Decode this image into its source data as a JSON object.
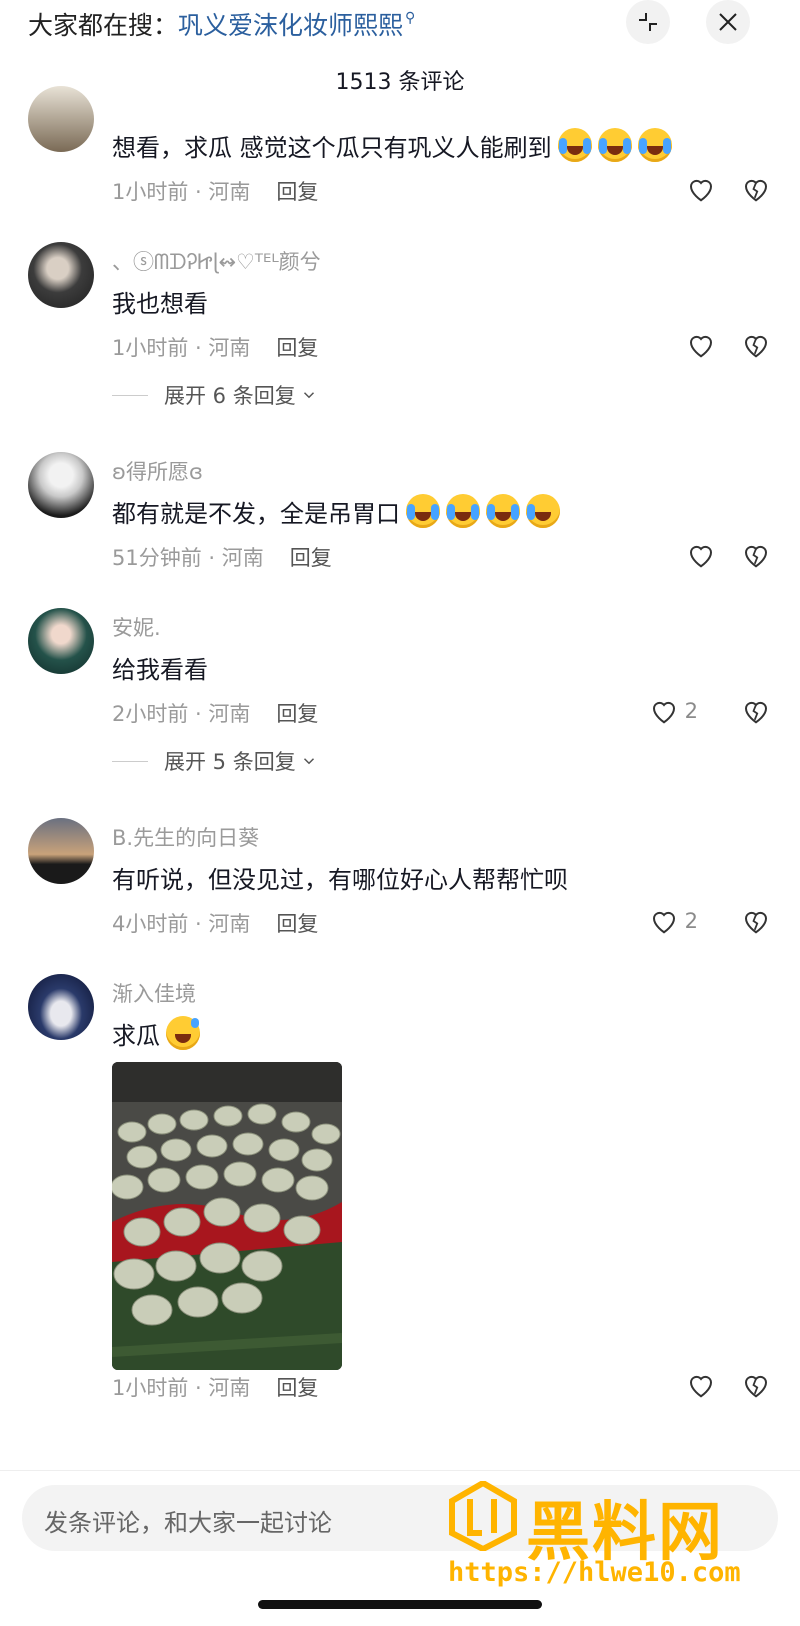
{
  "header": {
    "search_prefix": "大家都在搜：",
    "search_term": "巩义爱沫化妆师熙熙",
    "comment_count": "1513 条评论"
  },
  "comments": [
    {
      "username": "",
      "content": "想看，求瓜 感觉这个瓜只有巩义人能刷到",
      "emoji": [
        "laugh-cry",
        "laugh-cry",
        "laugh-cry"
      ],
      "time_location": "1小时前 · 河南",
      "reply_label": "回复",
      "likes": ""
    },
    {
      "username": "、ⓢᗰᗪᎮᏥɭ↭♡ᵀᴱᴸ颜兮",
      "content": "我也想看",
      "time_location": "1小时前 · 河南",
      "reply_label": "回复",
      "likes": "",
      "expand_label": "展开 6 条回复"
    },
    {
      "username": "ʚ得所愿ɞ",
      "content": "都有就是不发，全是吊胃口",
      "emoji": [
        "loud-cry",
        "loud-cry",
        "loud-cry",
        "teary-smile"
      ],
      "time_location": "51分钟前 · 河南",
      "reply_label": "回复",
      "likes": ""
    },
    {
      "username": "安妮.",
      "content": "给我看看",
      "time_location": "2小时前 · 河南",
      "reply_label": "回复",
      "likes": "2",
      "expand_label": "展开 5 条回复"
    },
    {
      "username": "B.先生的向日葵",
      "content": "有听说，但没见过，有哪位好心人帮帮忙呗",
      "time_location": "4小时前 · 河南",
      "reply_label": "回复",
      "likes": "2"
    },
    {
      "username": "渐入佳境",
      "content": "求瓜",
      "emoji": [
        "grin-sweat"
      ],
      "time_location": "1小时前 · 河南",
      "reply_label": "回复",
      "likes": ""
    }
  ],
  "input": {
    "placeholder": "发条评论，和大家一起讨论"
  },
  "watermark": {
    "brand": "黑料网",
    "url": "https://hlwe10.com"
  },
  "colors": {
    "link_blue": "#2b5f9e",
    "meta_gray": "#9a9a9a",
    "watermark_orange": "#ffb400"
  },
  "icons": [
    "search-icon",
    "collapse-icon",
    "close-icon",
    "heart-icon",
    "dislike-heart-icon",
    "chevron-down-icon"
  ]
}
